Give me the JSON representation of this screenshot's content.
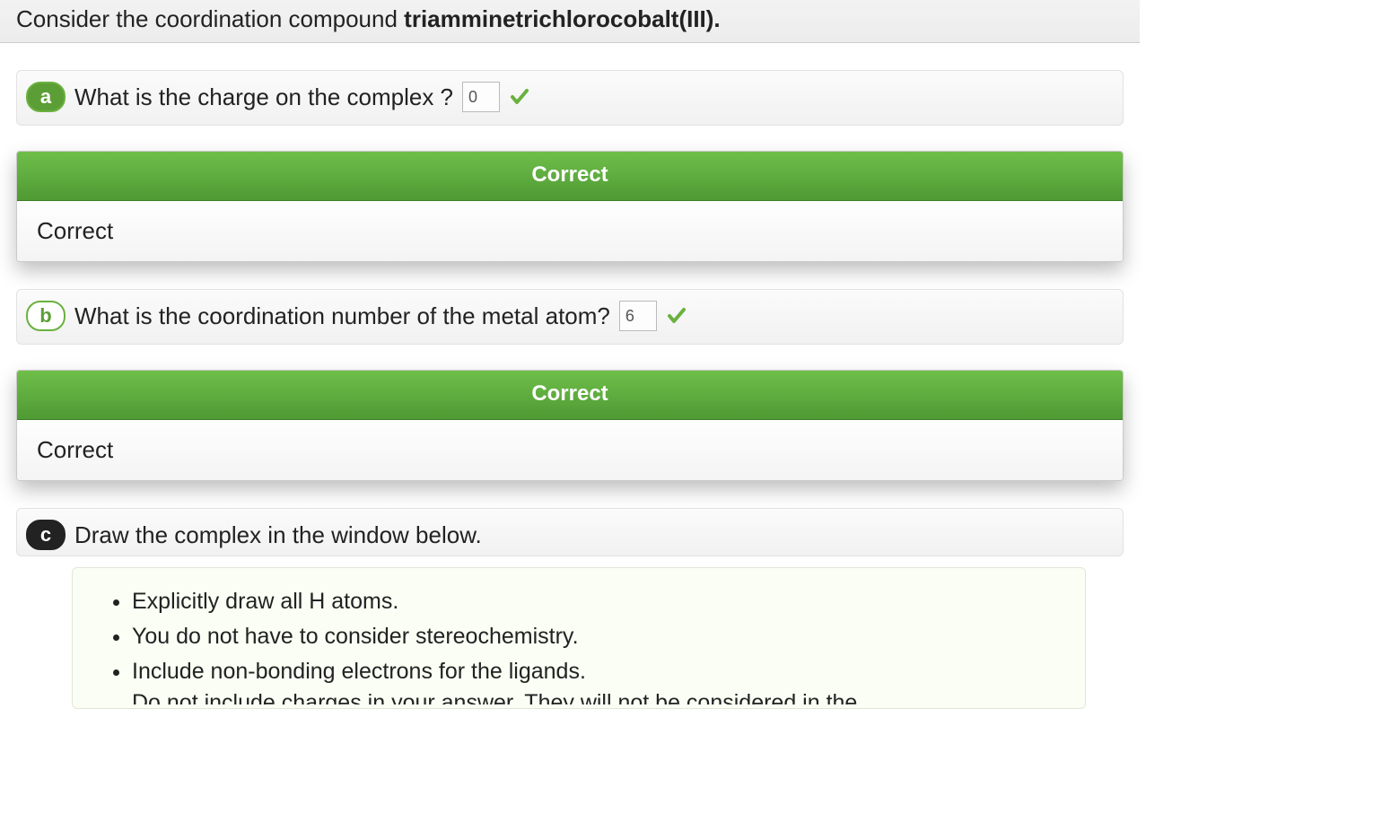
{
  "header": {
    "prefix": "Consider the coordination compound ",
    "compound": "triamminetrichlorocobalt(III).",
    "suffix": ""
  },
  "parts": {
    "a": {
      "label": "a",
      "question": "What is the charge on the complex ?",
      "answer": "0",
      "feedback_header": "Correct",
      "feedback_body": "Correct"
    },
    "b": {
      "label": "b",
      "question": "What is the coordination number of the metal atom?",
      "answer": "6",
      "feedback_header": "Correct",
      "feedback_body": "Correct"
    },
    "c": {
      "label": "c",
      "question": "Draw the complex in the window below.",
      "instructions": [
        "Explicitly draw all H atoms.",
        "You do not have to consider stereochemistry.",
        "Include non-bonding electrons for the ligands."
      ],
      "cutoff_line": "Do not include charges in your answer. They will not be considered in the"
    }
  }
}
